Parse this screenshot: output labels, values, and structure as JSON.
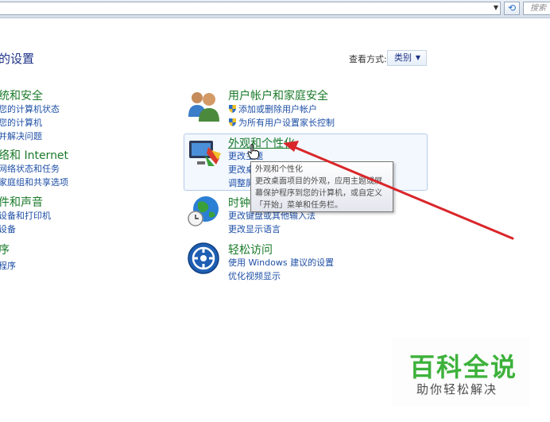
{
  "toolbar": {
    "search_placeholder": "搜索",
    "refresh_icon": "refresh-icon",
    "dropdown_icon": "chevron-down-icon"
  },
  "header": {
    "title": "的设置",
    "view_by_label": "查看方式:",
    "view_by_value": "类别"
  },
  "left_categories": [
    {
      "title": "统和安全",
      "links": [
        "您的计算机状态",
        "您的计算机",
        "并解决问题"
      ]
    },
    {
      "title": "络和 Internet",
      "links": [
        "网络状态和任务",
        "家庭组和共享选项"
      ]
    },
    {
      "title": "件和声音",
      "links": [
        "设备和打印机",
        "设备"
      ]
    },
    {
      "title": "序",
      "links": [
        "程序"
      ]
    }
  ],
  "right_categories": [
    {
      "title": "用户帐户和家庭安全",
      "links": [
        "添加或删除用户帐户",
        "为所有用户设置家长控制"
      ],
      "icon": "users-icon"
    },
    {
      "title": "外观和个性化",
      "links": [
        "更改主题",
        "更改桌",
        "调整屏"
      ],
      "icon": "appearance-icon"
    },
    {
      "title": "时钟",
      "links": [
        "更改键盘或其他输入法",
        "更改显示语言"
      ],
      "icon": "clock-globe-icon"
    },
    {
      "title": "轻松访问",
      "links": [
        "使用 Windows 建议的设置",
        "优化视频显示"
      ],
      "icon": "ease-of-access-icon"
    }
  ],
  "tooltip": {
    "lines": [
      "外观和个性化",
      "更改桌面项目的外观，应用主题或屏",
      "幕保护程序到您的计算机，或自定义",
      "「开始」菜单和任务栏。"
    ]
  },
  "watermark": {
    "title": "百科全说",
    "subtitle": "助你轻松解决"
  },
  "colors": {
    "category_title": "#1a7a29",
    "link": "#1e4fa6",
    "annotation_arrow": "#d9262a",
    "watermark": "#3db23b"
  }
}
